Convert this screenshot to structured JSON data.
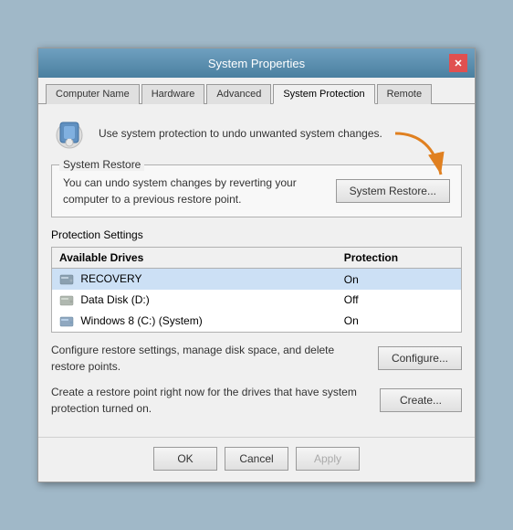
{
  "window": {
    "title": "System Properties",
    "close_label": "✕"
  },
  "tabs": [
    {
      "id": "computer-name",
      "label": "Computer Name",
      "active": false
    },
    {
      "id": "hardware",
      "label": "Hardware",
      "active": false
    },
    {
      "id": "advanced",
      "label": "Advanced",
      "active": false
    },
    {
      "id": "system-protection",
      "label": "System Protection",
      "active": true
    },
    {
      "id": "remote",
      "label": "Remote",
      "active": false
    }
  ],
  "header": {
    "description": "Use system protection to undo unwanted system changes."
  },
  "system_restore": {
    "group_label": "System Restore",
    "text": "You can undo system changes by reverting your computer to a previous restore point.",
    "button_label": "System Restore..."
  },
  "protection_settings": {
    "group_label": "Protection Settings",
    "columns": [
      "Available Drives",
      "Protection"
    ],
    "rows": [
      {
        "drive": "RECOVERY",
        "icon": "hdd",
        "protection": "On",
        "selected": true
      },
      {
        "drive": "Data Disk (D:)",
        "icon": "disk",
        "protection": "Off",
        "selected": false
      },
      {
        "drive": "Windows 8 (C:) (System)",
        "icon": "sys",
        "protection": "On",
        "selected": false
      }
    ],
    "configure_text": "Configure restore settings, manage disk space, and delete restore points.",
    "configure_button": "Configure...",
    "create_text": "Create a restore point right now for the drives that have system protection turned on.",
    "create_button": "Create..."
  },
  "footer": {
    "ok_label": "OK",
    "cancel_label": "Cancel",
    "apply_label": "Apply"
  }
}
